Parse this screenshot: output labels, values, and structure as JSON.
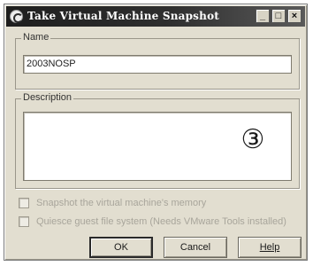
{
  "window": {
    "title": "Take Virtual Machine Snapshot",
    "minimize_glyph": "_",
    "maximize_glyph": "□",
    "close_glyph": "×"
  },
  "name_group": {
    "legend": "Name",
    "value": "2003NOSP"
  },
  "description_group": {
    "legend": "Description",
    "value": "",
    "marker": "③"
  },
  "options": [
    {
      "label": "Snapshot the virtual machine's memory",
      "checked": false,
      "enabled": false
    },
    {
      "label": "Quiesce guest file system (Needs VMware Tools installed)",
      "checked": false,
      "enabled": false
    }
  ],
  "buttons": {
    "ok": "OK",
    "cancel": "Cancel",
    "help": "Help"
  },
  "icons": {
    "app": "vmware-snapshot-icon"
  }
}
